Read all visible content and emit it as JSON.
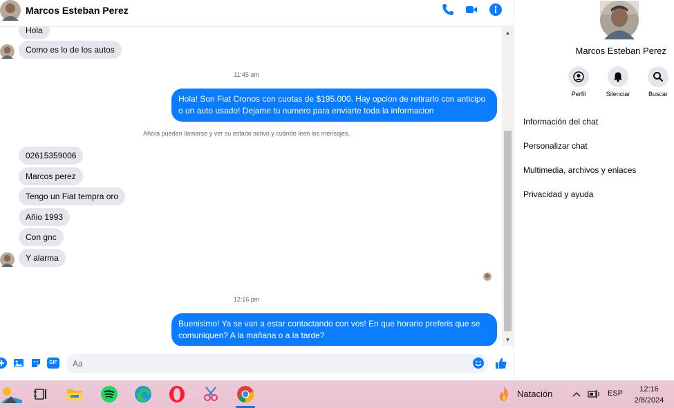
{
  "header": {
    "contact_name": "Marcos Esteban Perez",
    "icons": [
      "phone-icon",
      "video-icon",
      "info-icon"
    ]
  },
  "colors": {
    "accent": "#0a7cff",
    "bubble_in": "#e4e6eb",
    "taskbar": "#ecc9d7"
  },
  "messages": {
    "in_1": "Hola",
    "in_2": "Como es lo de los autos",
    "ts_1": "11:45 am",
    "out_1": "Hola! Son Fiat Cronos con cuotas de $195.000. Hay opcion de retirarlo con anticipo o un auto usado! Dejame tu numero para enviarte toda la informacion",
    "system": "Ahora pueden llamarse y ver su estado activo y cuándo leen los mensajes.",
    "in_3": "02615359006",
    "in_4": "Marcos perez",
    "in_5": "Tengo un Fiat tempra oro",
    "in_6": "Añio 1993",
    "in_7": "Con gnc",
    "in_8": "Y alarma",
    "ts_2": "12:16 pm",
    "out_2": "Buenisimo! Ya se van a estar contactando con vos! En que horario preferis que se comuniquen? A la mañana o a la tarde?"
  },
  "composer": {
    "placeholder": "Aa",
    "icons": [
      "plus-icon",
      "image-icon",
      "sticker-icon",
      "gif-icon",
      "emoji-icon",
      "thumbs-up-icon"
    ],
    "gif_label": "GIF"
  },
  "panel": {
    "contact_name": "Marcos Esteban Perez",
    "actions": [
      {
        "label": "Perfil",
        "icon": "profile-icon"
      },
      {
        "label": "Silenciar",
        "icon": "bell-icon"
      },
      {
        "label": "Buscar",
        "icon": "search-icon"
      }
    ],
    "menu": [
      "Información del chat",
      "Personalizar chat",
      "Multimedia, archivos y enlaces",
      "Privacidad y ayuda"
    ]
  },
  "taskbar": {
    "weather": "Natación",
    "lang": "ESP",
    "time": "12:16",
    "date": "2/8/2024",
    "apps": [
      "weather-widget-icon",
      "task-view-icon",
      "file-explorer-icon",
      "spotify-icon",
      "edge-icon",
      "opera-icon",
      "snipping-tool-icon",
      "chrome-icon"
    ]
  }
}
